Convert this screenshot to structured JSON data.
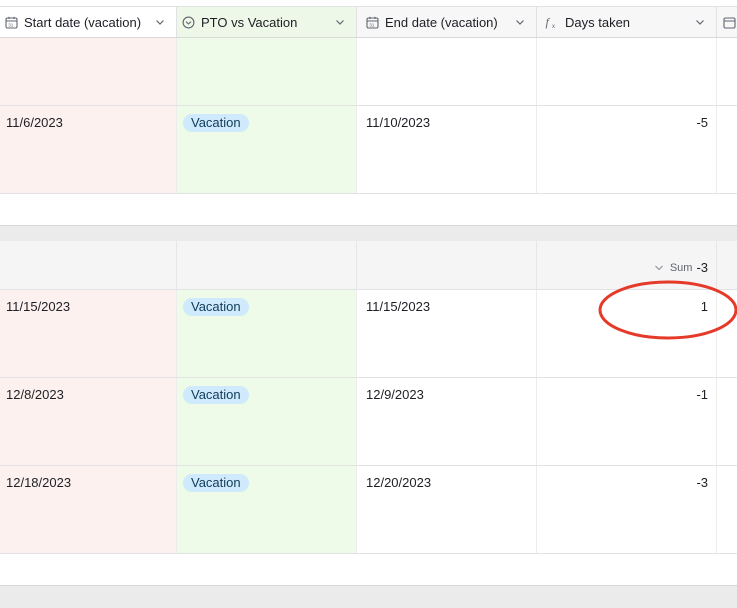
{
  "columns": [
    {
      "label": "Start date (vacation)",
      "icon": "calendar-icon"
    },
    {
      "label": "PTO vs Vacation",
      "icon": "single-select-icon"
    },
    {
      "label": "End date (vacation)",
      "icon": "calendar-icon"
    },
    {
      "label": "Days taken",
      "icon": "formula-icon"
    }
  ],
  "group1": {
    "rows": [
      {
        "start": "",
        "type": "",
        "end": "",
        "days": ""
      },
      {
        "start": "11/6/2023",
        "type": "Vacation",
        "end": "11/10/2023",
        "days": "-5"
      }
    ]
  },
  "group2": {
    "summary": {
      "label": "Sum",
      "value": "-3"
    },
    "rows": [
      {
        "start": "11/15/2023",
        "type": "Vacation",
        "end": "11/15/2023",
        "days": "1"
      },
      {
        "start": "12/8/2023",
        "type": "Vacation",
        "end": "12/9/2023",
        "days": "-1"
      },
      {
        "start": "12/18/2023",
        "type": "Vacation",
        "end": "12/20/2023",
        "days": "-3"
      }
    ]
  },
  "colors": {
    "annotation": "#e53a2a",
    "pill_bg": "#cfeafc",
    "start_col_bg": "#fdf1ef",
    "type_col_bg": "#edfbe8"
  }
}
